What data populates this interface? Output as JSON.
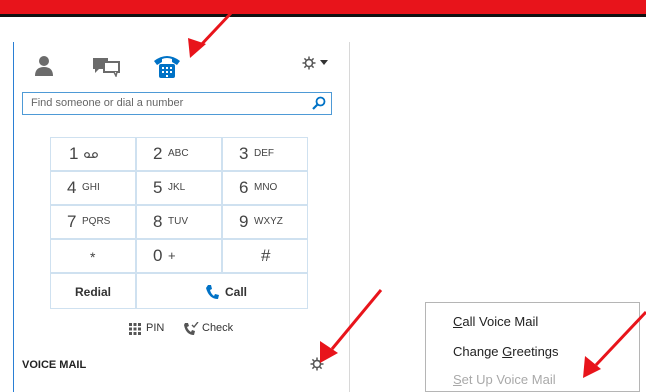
{
  "tabs": [
    {
      "name": "contacts",
      "icon": "person-icon"
    },
    {
      "name": "conversations",
      "icon": "chat-icon"
    },
    {
      "name": "phone",
      "icon": "phone-icon",
      "active": true
    }
  ],
  "search": {
    "placeholder": "Find someone or dial a number"
  },
  "dialpad": {
    "keys": [
      {
        "digit": "1",
        "letters": ""
      },
      {
        "digit": "2",
        "letters": "ABC"
      },
      {
        "digit": "3",
        "letters": "DEF"
      },
      {
        "digit": "4",
        "letters": "GHI"
      },
      {
        "digit": "5",
        "letters": "JKL"
      },
      {
        "digit": "6",
        "letters": "MNO"
      },
      {
        "digit": "7",
        "letters": "PQRS"
      },
      {
        "digit": "8",
        "letters": "TUV"
      },
      {
        "digit": "9",
        "letters": "WXYZ"
      },
      {
        "digit": "*",
        "letters": ""
      },
      {
        "digit": "0",
        "letters": "+"
      },
      {
        "digit": "#",
        "letters": ""
      }
    ],
    "redial_label": "Redial",
    "call_label": "Call"
  },
  "bottom_links": {
    "pin_label": "PIN",
    "check_label": "Check"
  },
  "voice_mail": {
    "section_label": "VOICE MAIL"
  },
  "menu": {
    "items": [
      {
        "prefix": "",
        "access": "C",
        "suffix": "all Voice Mail",
        "enabled": true
      },
      {
        "prefix": "Change ",
        "access": "G",
        "suffix": "reetings",
        "enabled": true
      },
      {
        "prefix": "",
        "access": "S",
        "suffix": "et Up Voice Mail",
        "enabled": false
      }
    ]
  },
  "colors": {
    "accent": "#0072c6",
    "annotation": "#e8141b"
  }
}
